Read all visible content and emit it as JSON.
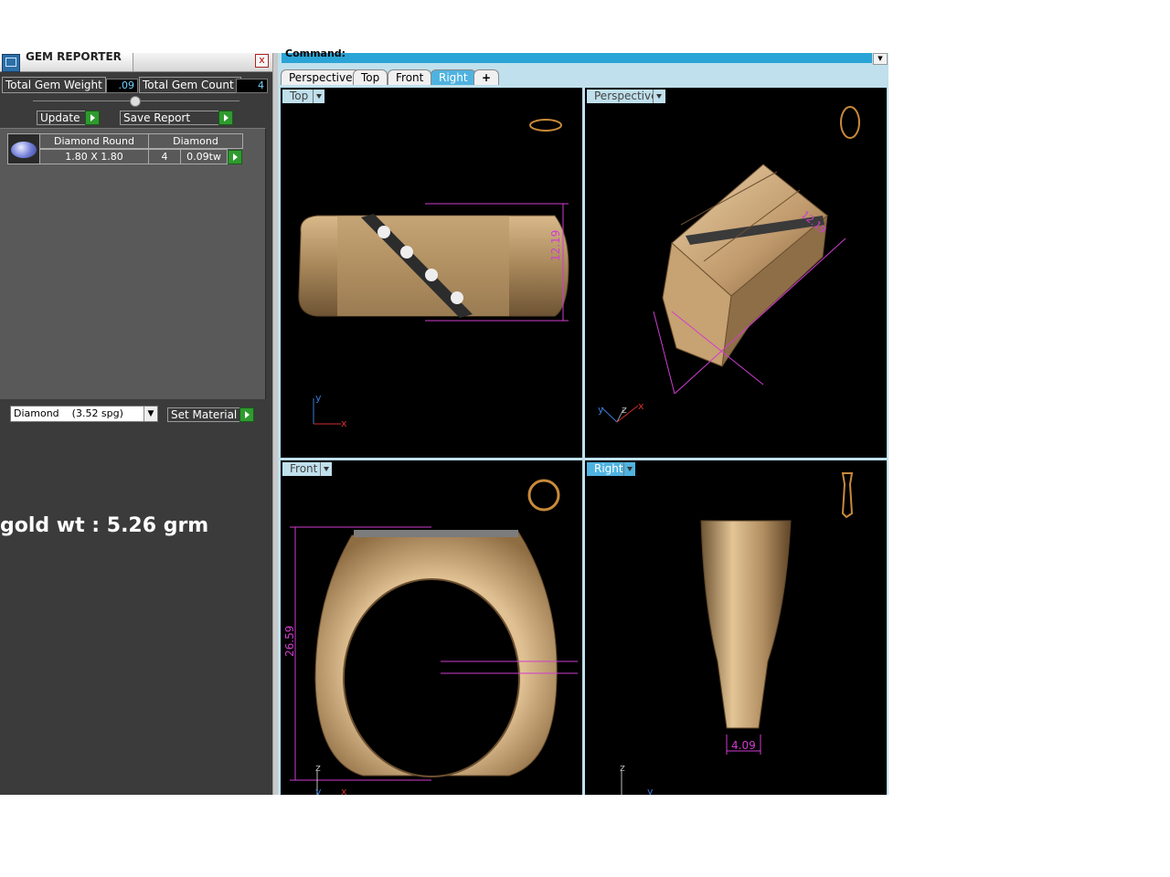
{
  "gem_reporter": {
    "title": "GEM REPORTER",
    "close_label": "x",
    "total_weight_label": "Total Gem Weight",
    "total_weight_value": ".09",
    "total_count_label": "Total Gem Count",
    "total_count_value": "4",
    "update_label": "Update",
    "save_report_label": "Save Report",
    "gem_row": {
      "shape": "Diamond Round",
      "size": "1.80 X 1.80",
      "material": "Diamond",
      "count": "4",
      "weight": "0.09tw"
    },
    "material_select_value": "Diamond    (3.52 spg)",
    "set_material_label": "Set Material"
  },
  "gold_weight_text": "gold wt : 5.26 grm",
  "command": {
    "label": "Command:",
    "scroll_icon": "chevron-down-icon"
  },
  "view_tabs": [
    {
      "label": "Perspective",
      "active": false
    },
    {
      "label": "Top",
      "active": false
    },
    {
      "label": "Front",
      "active": false
    },
    {
      "label": "Right",
      "active": true
    },
    {
      "label": "+",
      "active": false
    }
  ],
  "viewports": {
    "top": {
      "label": "Top",
      "dimension": "12.19",
      "axis_y": "y",
      "axis_x": "x"
    },
    "perspective": {
      "label": "Perspective",
      "dimension": "12.19",
      "axis_y": "y",
      "axis_z": "z",
      "axis_x": "x"
    },
    "front": {
      "label": "Front",
      "dimension": "26.59",
      "axis_z": "z",
      "axis_y": "y",
      "axis_x": "x"
    },
    "right": {
      "label": "Right",
      "dimension": "4.09",
      "axis_z": "z",
      "axis_y": "y"
    }
  },
  "colors": {
    "panel_bg": "#3b3b3b",
    "accent_blue": "#4fb3e0",
    "dimension_magenta": "#d03cd0",
    "gold": "#c9a77a"
  }
}
